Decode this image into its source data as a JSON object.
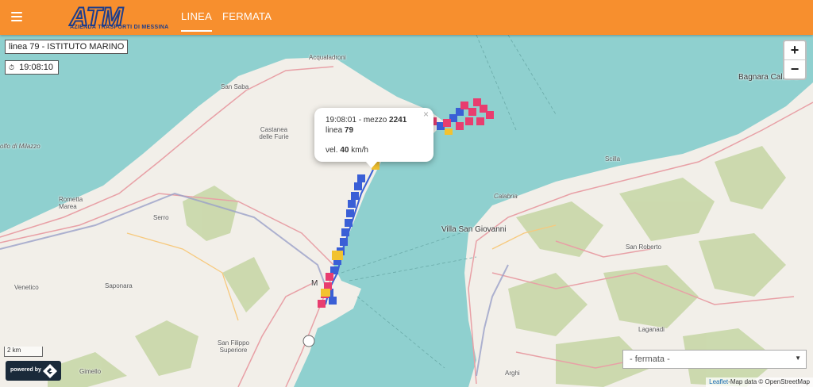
{
  "header": {
    "logo_text": "ATM",
    "logo_subtitle": "AZIENDA TRASPORTI DI MESSINA",
    "nav": [
      {
        "label": "LINEA",
        "active": true
      },
      {
        "label": "FERMATA",
        "active": false
      }
    ]
  },
  "map": {
    "line_label": "linea 79 - ISTITUTO MARINO",
    "clock": "19:08:10",
    "zoom_in": "+",
    "zoom_out": "−",
    "popup": {
      "time_prefix": "19:08:01 - mezzo ",
      "vehicle": "2241",
      "line_prefix": "linea ",
      "line": "79",
      "speed_prefix": "vel. ",
      "speed": "40",
      "speed_unit": " km/h",
      "close": "×"
    },
    "places": [
      "Acqualadroni",
      "San Saba",
      "Castanea delle Furie",
      "olfo di Milazzo",
      "Rometta Marea",
      "Serro",
      "Venetico",
      "Saponara",
      "Villa San Giovanni",
      "Bagnara Calabra",
      "Scilla",
      "Calabria",
      "San Roberto",
      "Laganadi",
      "San Filippo Superiore",
      "Gimello",
      "Arghi",
      "M"
    ],
    "scale": "2 km",
    "powered_by": "powered by",
    "select_placeholder": "- fermata -",
    "attribution_link": "Leaflet",
    "attribution_text": "-Map data © OpenStreetMap"
  },
  "colors": {
    "header": "#f78f2e",
    "sea": "#8fd0cf",
    "land": "#f2efe9",
    "bus_blue": "#3a5fd6",
    "bus_red": "#e83d6f",
    "bus_yellow": "#f2c230"
  }
}
